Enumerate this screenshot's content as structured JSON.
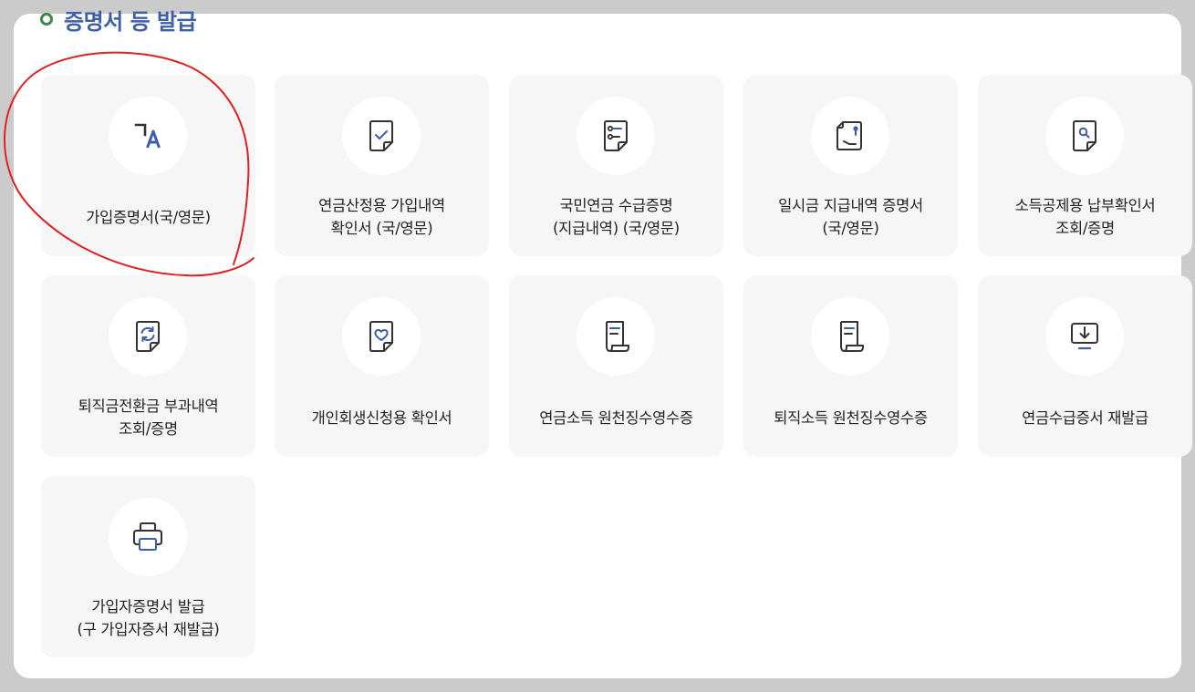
{
  "page": {
    "title": "증명서 등 발급"
  },
  "colors": {
    "accent": "#3d5ea8",
    "bullet": "#3b8a4a",
    "annotation": "#e02020",
    "card_bg": "#f6f6f6",
    "text": "#222222"
  },
  "cards": [
    {
      "icon": "translate-icon",
      "lines": [
        "가입증명서(국/영문)"
      ]
    },
    {
      "icon": "document-check-icon",
      "lines": [
        "연금산정용 가입내역",
        "확인서 (국/영문)"
      ]
    },
    {
      "icon": "document-list-icon",
      "lines": [
        "국민연금 수급증명",
        "(지급내역) (국/영문)"
      ]
    },
    {
      "icon": "document-pin-icon",
      "lines": [
        "일시금 지급내역 증명서",
        "(국/영문)"
      ]
    },
    {
      "icon": "document-search-icon",
      "lines": [
        "소득공제용 납부확인서",
        "조회/증명"
      ]
    },
    {
      "icon": "document-refresh-icon",
      "lines": [
        "퇴직금전환금 부과내역",
        "조회/증명"
      ]
    },
    {
      "icon": "document-heart-icon",
      "lines": [
        "개인회생신청용 확인서"
      ]
    },
    {
      "icon": "scroll-receipt-icon",
      "lines": [
        "연금소득 원천징수영수증"
      ]
    },
    {
      "icon": "scroll-receipt-icon",
      "lines": [
        "퇴직소득 원천징수영수증"
      ]
    },
    {
      "icon": "download-tray-icon",
      "lines": [
        "연금수급증서 재발급"
      ]
    },
    {
      "icon": "printer-icon",
      "lines": [
        "가입자증명서 발급",
        "(구 가입자증서 재발급)"
      ]
    }
  ]
}
